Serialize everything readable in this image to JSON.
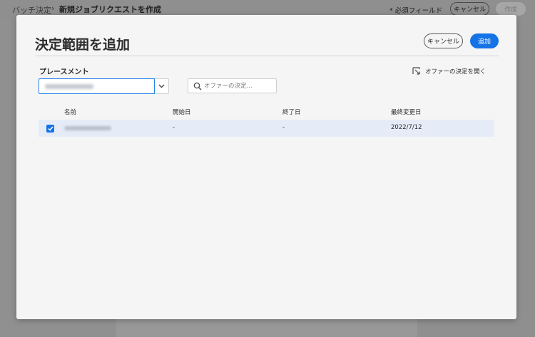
{
  "app": {
    "breadcrumb_root": "バッチ決定",
    "breadcrumb_separator": "›",
    "breadcrumb_current": "新規ジョブリクエストを作成",
    "required_note": "* 必須フィールド",
    "cancel_label": "キャンセル",
    "create_label": "作成"
  },
  "modal": {
    "title": "決定範囲を追加",
    "cancel_label": "キャンセル",
    "add_label": "追加",
    "placement_label": "プレースメント",
    "search_placeholder": "オファーの決定...",
    "open_link_label": "オファーの決定を開く",
    "columns": [
      "名前",
      "開始日",
      "終了日",
      "最終変更日"
    ],
    "rows": [
      {
        "selected": true,
        "start": "-",
        "end": "-",
        "modified": "2022/7/12"
      }
    ]
  },
  "colors": {
    "accent": "#1473e6",
    "row_selected_bg": "#e5ecf8",
    "overlay": "#8f8f8f"
  }
}
